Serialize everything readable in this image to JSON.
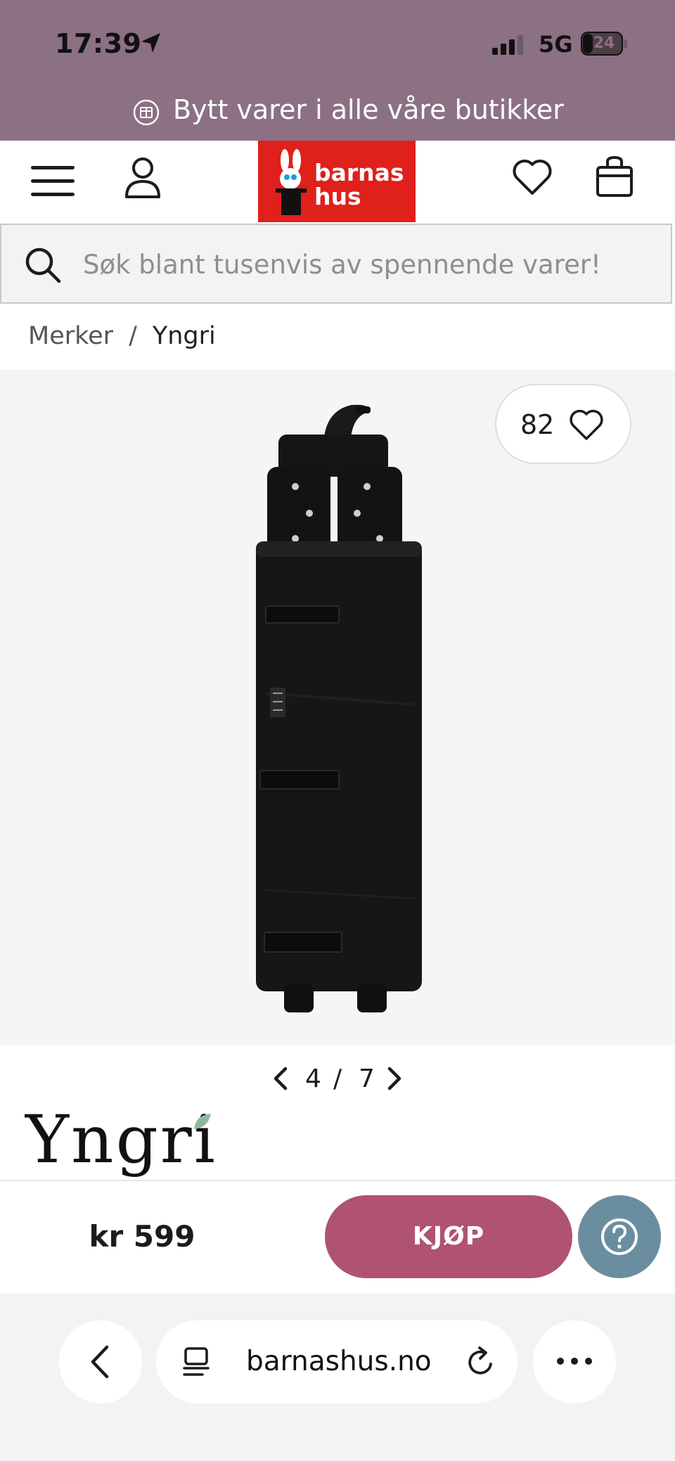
{
  "status_bar": {
    "time": "17:39",
    "network": "5G",
    "battery": "24",
    "icons": [
      "location-arrow-icon",
      "signal-icon",
      "battery-icon"
    ]
  },
  "promo": {
    "text": "Bytt varer i alle våre butikker",
    "icon": "exchange-box-icon"
  },
  "header": {
    "logo_line1": "barnas",
    "logo_line2": "hus",
    "logo_color": "#e0201b",
    "icons": [
      "menu-icon",
      "account-icon",
      "wishlist-icon",
      "cart-icon"
    ]
  },
  "search": {
    "placeholder": "Søk blant tusenvis av spennende varer!"
  },
  "breadcrumb": {
    "items": [
      "Merker",
      "Yngri"
    ],
    "separator": "/"
  },
  "product": {
    "like_count": "82",
    "image_index": "4",
    "image_separator": "/",
    "image_total": "7",
    "brand_logo": "Yngri",
    "price": "kr 599",
    "buy_label": "KJØP",
    "buy_color": "#b05273",
    "help_color": "#6a8ea0"
  },
  "browser": {
    "url": "barnashus.no",
    "icons": [
      "back-icon",
      "reader-icon",
      "reload-icon",
      "more-icon"
    ]
  }
}
